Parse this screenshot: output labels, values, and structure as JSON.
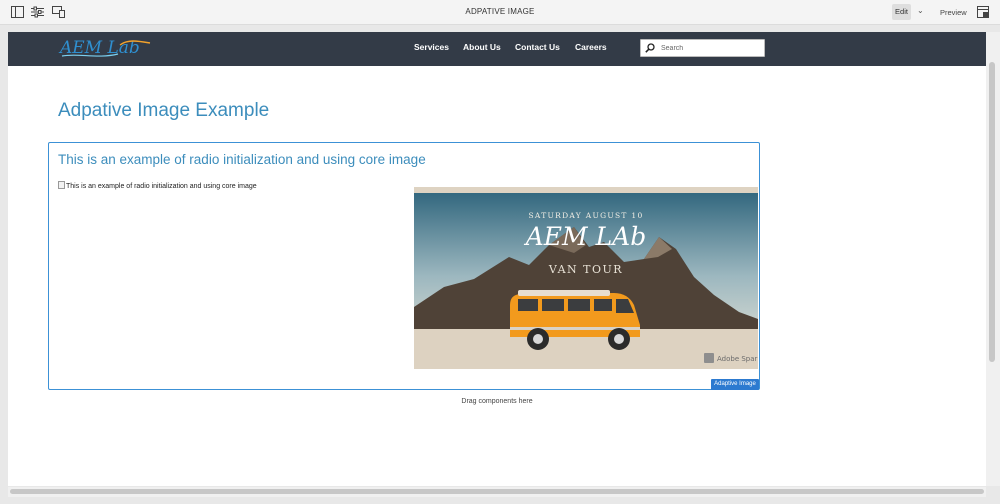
{
  "editor": {
    "page_title": "ADPATIVE IMAGE",
    "edit_label": "Edit",
    "preview_label": "Preview",
    "icons": [
      "side-panel-icon",
      "properties-icon",
      "emulator-icon",
      "chevron-down-icon",
      "annotations-icon"
    ]
  },
  "site": {
    "logo_text": "AEM Lab",
    "nav": [
      "Services",
      "About Us",
      "Contact Us",
      "Careers"
    ],
    "search_placeholder": "Search"
  },
  "page": {
    "title": "Adpative Image Example"
  },
  "component": {
    "title": "This is an example of radio initialization and using core image",
    "image_alt": "This is an example of radio initialization and using core image",
    "badge": "Adaptive Image",
    "hero": {
      "top_line": "SATURDAY AUGUST 10",
      "brand": "AEM LAb",
      "sub": "VAN TOUR",
      "watermark": "Adobe Spark"
    }
  },
  "drag_hint": "Drag components here",
  "colors": {
    "nav_bg": "#333b47",
    "heading": "#3c8dbc",
    "selection": "#3c91d6",
    "badge": "#2c7ad0",
    "van": "#f29a1d"
  }
}
